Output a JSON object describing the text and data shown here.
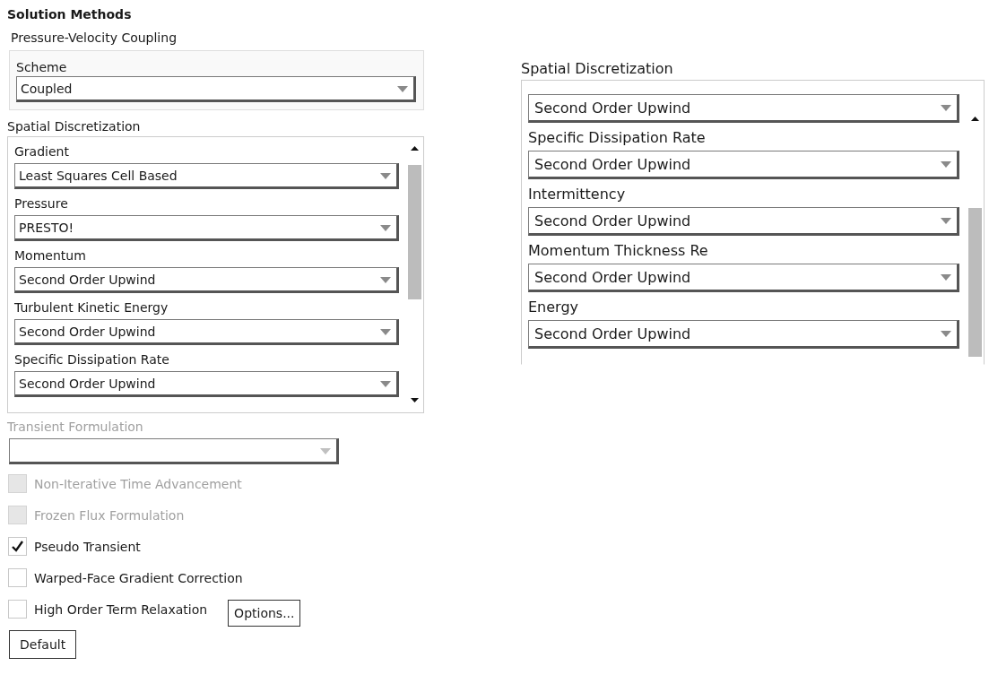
{
  "title": "Solution Methods",
  "pressure_velocity_coupling": {
    "label": "Pressure-Velocity Coupling",
    "scheme": {
      "label": "Scheme",
      "value": "Coupled"
    }
  },
  "spatial_discretization_panels": [
    {
      "label": "Spatial Discretization",
      "fields": [
        {
          "label": "Gradient",
          "value": "Least Squares Cell Based"
        },
        {
          "label": "Pressure",
          "value": "PRESTO!"
        },
        {
          "label": "Momentum",
          "value": "Second Order Upwind"
        },
        {
          "label": "Turbulent Kinetic Energy",
          "value": "Second Order Upwind"
        },
        {
          "label": "Specific Dissipation Rate",
          "value": "Second Order Upwind"
        }
      ]
    },
    {
      "label": "Spatial Discretization",
      "fields": [
        {
          "value": "Second Order Upwind"
        },
        {
          "label": "Specific Dissipation Rate",
          "value": "Second Order Upwind"
        },
        {
          "label": "Intermittency",
          "value": "Second Order Upwind"
        },
        {
          "label": "Momentum Thickness Re",
          "value": "Second Order Upwind"
        },
        {
          "label": "Energy",
          "value": "Second Order Upwind"
        }
      ]
    }
  ],
  "transient_formulation": {
    "label": "Transient Formulation",
    "disabled": true
  },
  "options": [
    {
      "label": "Non-Iterative Time Advancement",
      "checked": false,
      "disabled": true
    },
    {
      "label": "Frozen Flux Formulation",
      "checked": false,
      "disabled": true
    },
    {
      "label": "Pseudo Transient",
      "checked": true,
      "disabled": false
    },
    {
      "label": "Warped-Face Gradient Correction",
      "checked": false,
      "disabled": false
    },
    {
      "label": "High Order Term Relaxation",
      "checked": false,
      "disabled": false,
      "button": "Options..."
    }
  ],
  "buttons": [
    "Default"
  ]
}
